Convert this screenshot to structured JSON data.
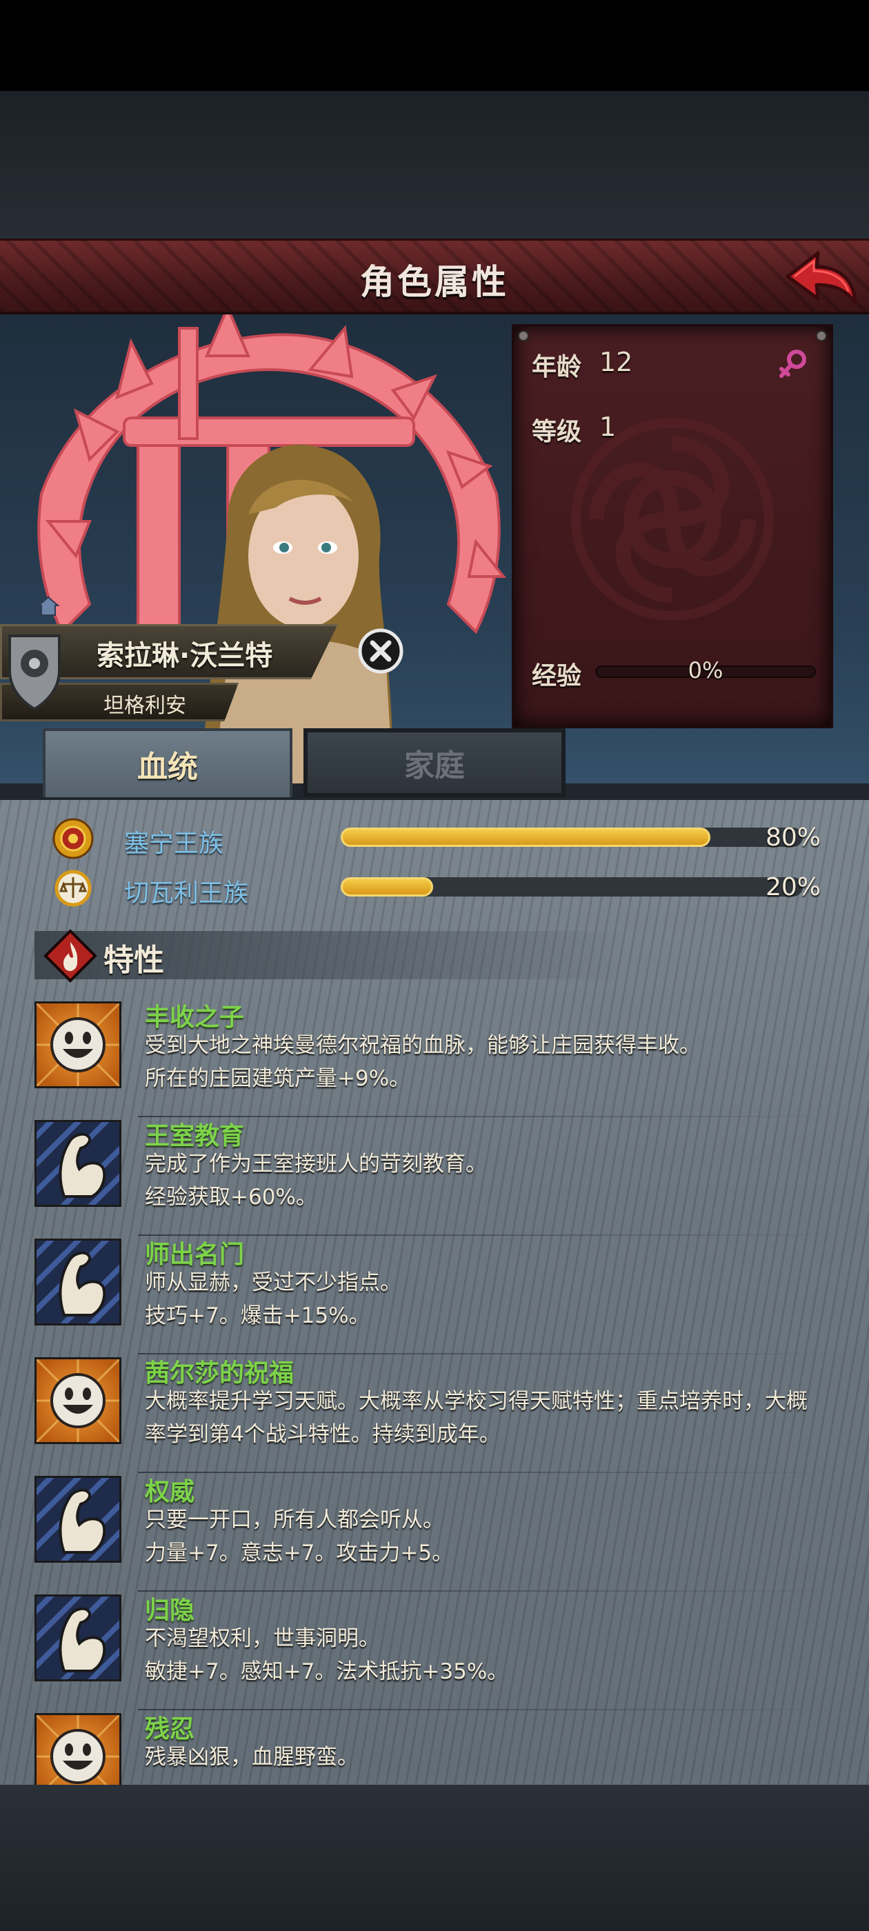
{
  "header": {
    "title": "角色属性"
  },
  "character": {
    "name": "索拉琳·沃兰特",
    "family": "坦格利安"
  },
  "stats": {
    "age_label": "年龄",
    "age_value": "12",
    "level_label": "等级",
    "level_value": "1",
    "exp_label": "经验",
    "exp_value": "0%",
    "exp_progress": 0
  },
  "tabs": [
    {
      "label": "血统",
      "active": true
    },
    {
      "label": "家庭",
      "active": false
    }
  ],
  "lineage": [
    {
      "name": "塞宁王族",
      "percent": "80%",
      "fraction": 0.8
    },
    {
      "name": "切瓦利王族",
      "percent": "20%",
      "fraction": 0.2
    }
  ],
  "traits_title": "特性",
  "traits": [
    {
      "name": "丰收之子",
      "desc1": "受到大地之神埃曼德尔祝福的血脉，能够让庄园获得丰收。",
      "desc2": "所在的庄园建筑产量+9%。",
      "icon": "smiley-icon"
    },
    {
      "name": "王室教育",
      "desc1": "完成了作为王室接班人的苛刻教育。",
      "desc2": "经验获取+60%。",
      "icon": "muscle-arm-icon"
    },
    {
      "name": "师出名门",
      "desc1": "师从显赫，受过不少指点。",
      "desc2": "技巧+7。爆击+15%。",
      "icon": "muscle-arm-icon"
    },
    {
      "name": "茜尔莎的祝福",
      "desc1": "大概率提升学习天赋。大概率从学校习得天赋特性；重点培养时，大概",
      "desc2": "率学到第4个战斗特性。持续到成年。",
      "icon": "smiley-icon"
    },
    {
      "name": "权威",
      "desc1": "只要一开口，所有人都会听从。",
      "desc2": "力量+7。意志+7。攻击力+5。",
      "icon": "muscle-arm-icon"
    },
    {
      "name": "归隐",
      "desc1": "不渴望权利，世事洞明。",
      "desc2": "敏捷+7。感知+7。法术抵抗+35%。",
      "icon": "muscle-arm-icon"
    },
    {
      "name": "残忍",
      "desc1": "残暴凶狠，血腥野蛮。",
      "desc2": "",
      "icon": "smiley-icon"
    }
  ],
  "colors": {
    "header": "#5a2225",
    "trait_name": "#7dd34a",
    "lineage_name": "#7ec0e6",
    "bar_fill": "#e8b02c",
    "tab_active_text": "#f3e3b8"
  }
}
